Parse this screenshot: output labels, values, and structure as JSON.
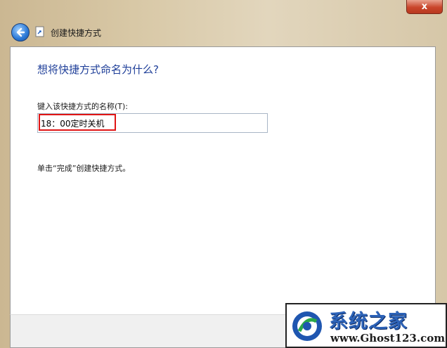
{
  "window": {
    "close_label": "x",
    "title": "创建快捷方式"
  },
  "content": {
    "heading": "想将快捷方式命名为什么?",
    "field_label": "键入该快捷方式的名称(T):",
    "field_value": "18：00定时关机",
    "hint": "单击“完成”创建快捷方式。"
  },
  "watermark": {
    "title": "系统之家",
    "url": "www.Ghost123.com"
  },
  "colors": {
    "heading": "#1f3f99",
    "highlight": "#e01515",
    "close": "#c9462c"
  },
  "icons": [
    "back-arrow-icon",
    "shortcut-wizard-icon",
    "close-icon"
  ]
}
